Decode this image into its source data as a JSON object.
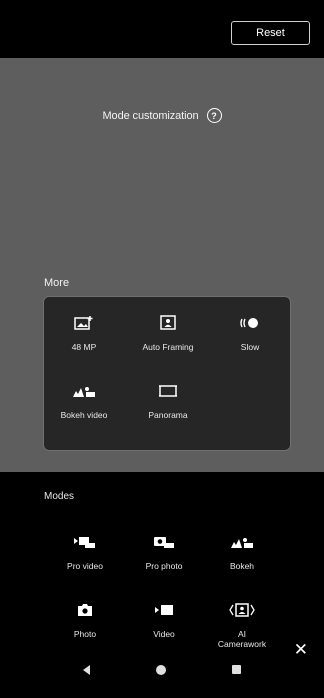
{
  "top_bar": {
    "reset_label": "Reset"
  },
  "header": {
    "title": "Mode customization",
    "help_icon": "question-circle-icon",
    "help_glyph": "?"
  },
  "more": {
    "label": "More",
    "items": [
      {
        "label": "48 MP",
        "icon": "image-plus-icon"
      },
      {
        "label": "Auto Framing",
        "icon": "frame-person-icon"
      },
      {
        "label": "Slow",
        "icon": "slow-motion-icon"
      },
      {
        "label": "Bokeh video",
        "icon": "bokeh-video-icon"
      },
      {
        "label": "Panorama",
        "icon": "panorama-icon"
      }
    ]
  },
  "modes": {
    "label": "Modes",
    "items": [
      {
        "label": "Pro video",
        "icon": "pro-video-icon"
      },
      {
        "label": "Pro photo",
        "icon": "pro-photo-icon"
      },
      {
        "label": "Bokeh",
        "icon": "bokeh-icon"
      },
      {
        "label": "Photo",
        "icon": "camera-icon"
      },
      {
        "label": "Video",
        "icon": "video-icon"
      },
      {
        "label": "AI\nCamerawork",
        "icon": "ai-camerawork-icon"
      }
    ]
  },
  "close_glyph": "✕",
  "nav": {
    "back": "back-icon",
    "home": "home-icon",
    "recent": "recent-apps-icon"
  }
}
